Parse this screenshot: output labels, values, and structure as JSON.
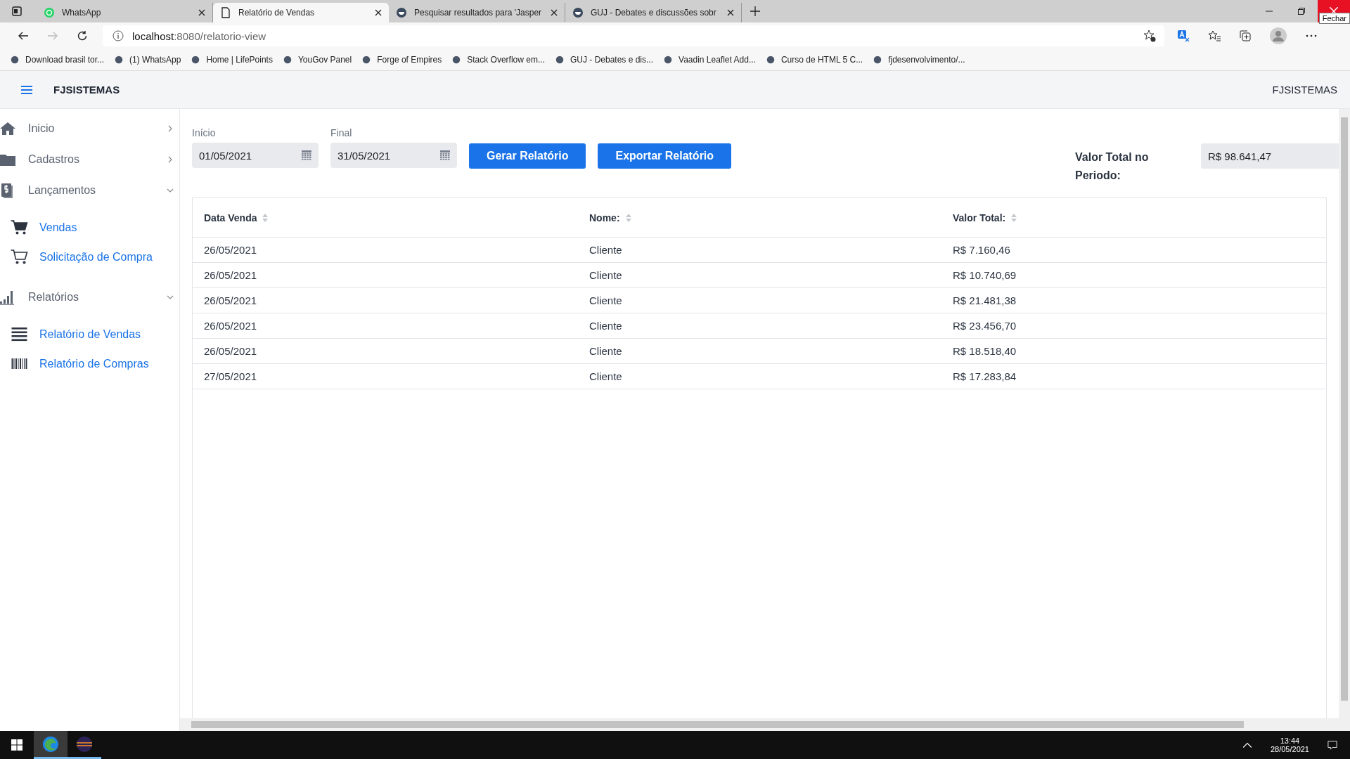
{
  "browser": {
    "tabs": [
      {
        "title": "WhatsApp",
        "kind": "whatsapp",
        "selected": false
      },
      {
        "title": "Relatório de Vendas",
        "kind": "page",
        "selected": true
      },
      {
        "title": "Pesquisar resultados para 'Jasper",
        "kind": "guj",
        "selected": false
      },
      {
        "title": "GUJ - Debates e discussões sobr",
        "kind": "guj",
        "selected": false
      }
    ],
    "tooltip": "Fechar",
    "address": {
      "host": "localhost",
      "path": ":8080/relatorio-view"
    },
    "bookmarks": [
      {
        "label": "Download brasil tor..."
      },
      {
        "label": "(1) WhatsApp"
      },
      {
        "label": "Home | LifePoints"
      },
      {
        "label": "YouGov Panel"
      },
      {
        "label": "Forge of Empires"
      },
      {
        "label": "Stack Overflow em..."
      },
      {
        "label": "GUJ - Debates e dis..."
      },
      {
        "label": "Vaadin Leaflet Add..."
      },
      {
        "label": "Curso de HTML 5 C..."
      },
      {
        "label": "fjdesenvolvimento/..."
      }
    ]
  },
  "app": {
    "brand": "FJSISTEMAS",
    "brand_right": "FJSISTEMAS",
    "sidebar": [
      {
        "label": "Inicio",
        "kind": "home",
        "expanded": false
      },
      {
        "label": "Cadastros",
        "kind": "folder",
        "expanded": false
      },
      {
        "label": "Lançamentos",
        "kind": "document",
        "expanded": true,
        "children": [
          {
            "label": "Vendas",
            "kind": "cart-filled"
          },
          {
            "label": "Solicitação de Compra",
            "kind": "cart"
          }
        ]
      },
      {
        "label": "Relatórios",
        "kind": "chart",
        "expanded": true,
        "children": [
          {
            "label": "Relatório de Vendas",
            "kind": "list"
          },
          {
            "label": "Relatório de Compras",
            "kind": "barcode"
          }
        ]
      }
    ],
    "fields": [
      {
        "label": "Início",
        "value": "01/05/2021"
      },
      {
        "label": "Final",
        "value": "31/05/2021"
      }
    ],
    "buttons": [
      "Gerar Relatório",
      "Exportar Relatório"
    ],
    "total": {
      "label": "Valor Total no Periodo:",
      "value": "R$ 98.641,47"
    },
    "table": {
      "columns": [
        "Data Venda",
        "Nome:",
        "Valor Total:"
      ],
      "rows": [
        [
          "26/05/2021",
          "Cliente",
          "R$ 7.160,46"
        ],
        [
          "26/05/2021",
          "Cliente",
          "R$ 10.740,69"
        ],
        [
          "26/05/2021",
          "Cliente",
          "R$ 21.481,38"
        ],
        [
          "26/05/2021",
          "Cliente",
          "R$ 23.456,70"
        ],
        [
          "26/05/2021",
          "Cliente",
          "R$ 18.518,40"
        ],
        [
          "27/05/2021",
          "Cliente",
          "R$ 17.283,84"
        ]
      ]
    }
  },
  "taskbar": {
    "apps": [
      {
        "kind": "edge",
        "selected": true
      },
      {
        "kind": "eclipse",
        "selected": false
      }
    ],
    "time": "13:44",
    "date": "28/05/2021"
  }
}
